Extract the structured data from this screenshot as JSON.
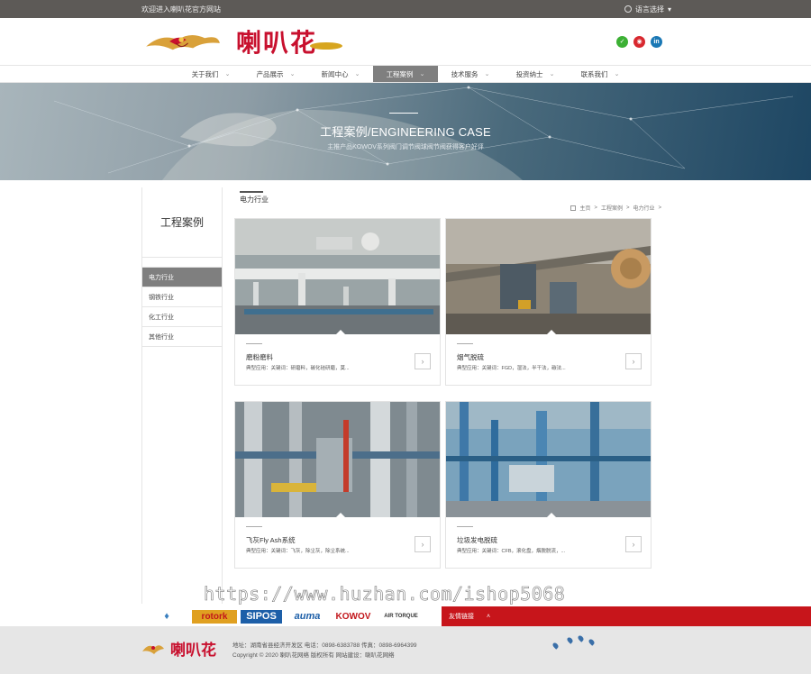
{
  "topbar": {
    "welcome": "欢迎进入喇叭花官方网站",
    "language": "语言选择"
  },
  "header": {
    "brand": "喇叭花",
    "social_icons": [
      "wechat-icon",
      "weibo-icon",
      "linkedin-icon"
    ]
  },
  "nav": {
    "items": [
      {
        "label": "关于我们",
        "active": false
      },
      {
        "label": "产品展示",
        "active": false
      },
      {
        "label": "新闻中心",
        "active": false
      },
      {
        "label": "工程案例",
        "active": true
      },
      {
        "label": "技术服务",
        "active": false
      },
      {
        "label": "投资纳士",
        "active": false
      },
      {
        "label": "联系我们",
        "active": false
      }
    ]
  },
  "banner": {
    "title": "工程案例/ENGINEERING CASE",
    "subtitle": "主推产品KOWOV系列阀门调节阀球阀节阀获得客户好评"
  },
  "sidebar": {
    "title": "工程案例",
    "items": [
      {
        "label": "电力行业",
        "active": true
      },
      {
        "label": "钢铁行业",
        "active": false
      },
      {
        "label": "化工行业",
        "active": false
      },
      {
        "label": "其他行业",
        "active": false
      }
    ]
  },
  "main": {
    "section_title": "电力行业",
    "breadcrumb": [
      "主页",
      ">",
      "工程案例",
      ">",
      "电力行业",
      ">"
    ]
  },
  "cases": [
    {
      "title": "磨粉磨料",
      "desc": "典型应用：关键词：研磨料，碳化硅研磨，莫..."
    },
    {
      "title": "烟气脱硫",
      "desc": "典型应用：关键词：FGD，湿法，半干法，碳法..."
    },
    {
      "title": "飞灰Fly Ash系统",
      "desc": "典型应用：关键词：飞灰，除尘灰，除尘系统..."
    },
    {
      "title": "垃圾发电脱硫",
      "desc": "典型应用：关键词：CFB，滚化盘，烟脱脱流，..."
    }
  ],
  "watermark": "https://www.huzhan.com/ishop5068",
  "partners": {
    "logos": [
      "rotork",
      "SIPOS",
      "auma",
      "KOWOV",
      "AIR TORQUE"
    ],
    "links_label": "友情链接"
  },
  "footer": {
    "brand": "喇叭花",
    "address": "地址：湖南省县经济开发区 电话：0898-6383788 传真：0898-6964399",
    "copyright": "Copyright © 2020 喇叭花网络 版权所有 网站建设：喇叭花网络"
  }
}
